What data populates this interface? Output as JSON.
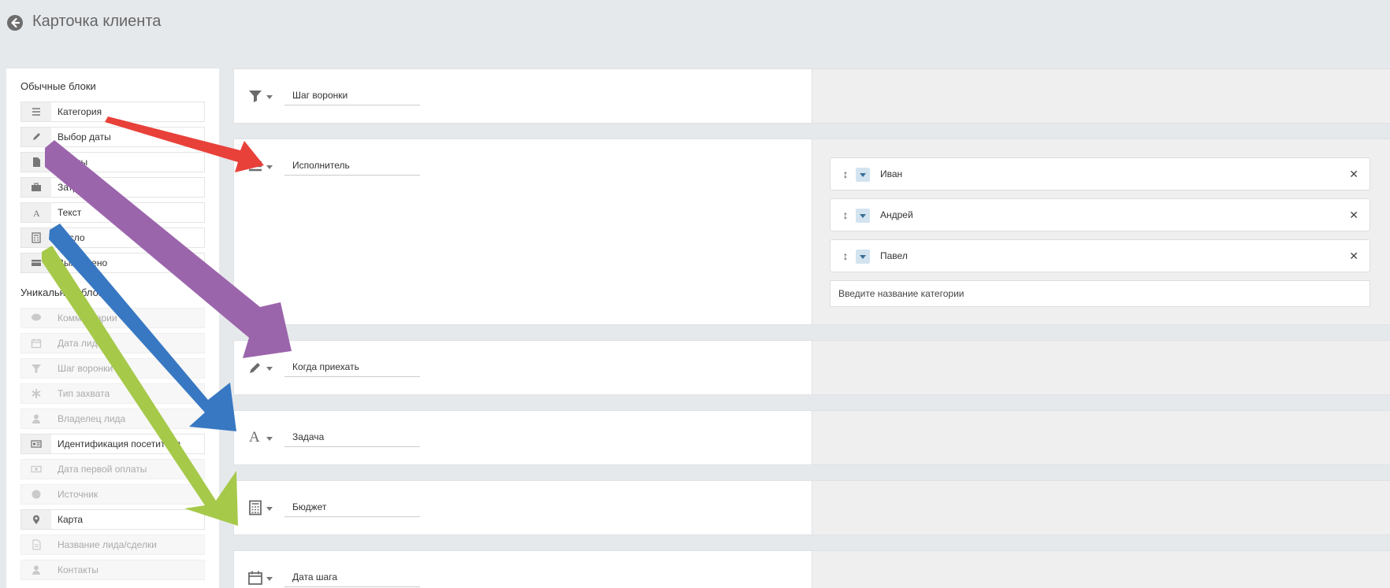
{
  "header": {
    "title": "Карточка клиента"
  },
  "palette": {
    "regular_heading": "Обычные блоки",
    "regular": [
      {
        "label": "Категория",
        "icon": "list-icon"
      },
      {
        "label": "Выбор даты",
        "icon": "pencil-icon"
      },
      {
        "label": "Файлы",
        "icon": "file-icon"
      },
      {
        "label": "Затраты",
        "icon": "briefcase-icon"
      },
      {
        "label": "Текст",
        "icon": "text-a-icon"
      },
      {
        "label": "Число",
        "icon": "calculator-icon"
      },
      {
        "label": "Выполнено",
        "icon": "card-icon"
      }
    ],
    "unique_heading": "Уникальные блоки",
    "unique": [
      {
        "label": "Комментарии",
        "icon": "comment-icon",
        "enabled": false
      },
      {
        "label": "Дата лида",
        "icon": "calendar-icon",
        "enabled": false
      },
      {
        "label": "Шаг воронки",
        "icon": "filter-icon",
        "enabled": false
      },
      {
        "label": "Тип захвата",
        "icon": "asterisk-icon",
        "enabled": false
      },
      {
        "label": "Владелец лида",
        "icon": "user-icon",
        "enabled": false
      },
      {
        "label": "Идентификация посетителя",
        "icon": "id-card-icon",
        "enabled": true
      },
      {
        "label": "Дата первой оплаты",
        "icon": "money-icon",
        "enabled": false
      },
      {
        "label": "Источник",
        "icon": "pie-icon",
        "enabled": false
      },
      {
        "label": "Карта",
        "icon": "map-marker-icon",
        "enabled": true
      },
      {
        "label": "Название лида/сделки",
        "icon": "document-icon",
        "enabled": false
      },
      {
        "label": "Контакты",
        "icon": "user-icon",
        "enabled": false
      }
    ]
  },
  "blocks": [
    {
      "icon": "filter-icon",
      "field": "Шаг воронки"
    },
    {
      "icon": "list-icon",
      "field": "Исполнитель"
    },
    {
      "icon": "pencil-icon",
      "field": "Когда приехать"
    },
    {
      "icon": "text-a-icon",
      "field": "Задача"
    },
    {
      "icon": "calculator-icon",
      "field": "Бюджет"
    },
    {
      "icon": "calendar-icon",
      "field": "Дата шага"
    }
  ],
  "category_options": [
    "Иван",
    "Андрей",
    "Павел"
  ],
  "category_placeholder": "Введите название категории",
  "colors": {
    "arrow_red": "#e8413a",
    "arrow_purple": "#9b65ac",
    "arrow_blue": "#3878c2",
    "arrow_green": "#a6c94a",
    "icon_gray": "#6b6b6b",
    "dropdown_blue": "#d3e4f0"
  }
}
